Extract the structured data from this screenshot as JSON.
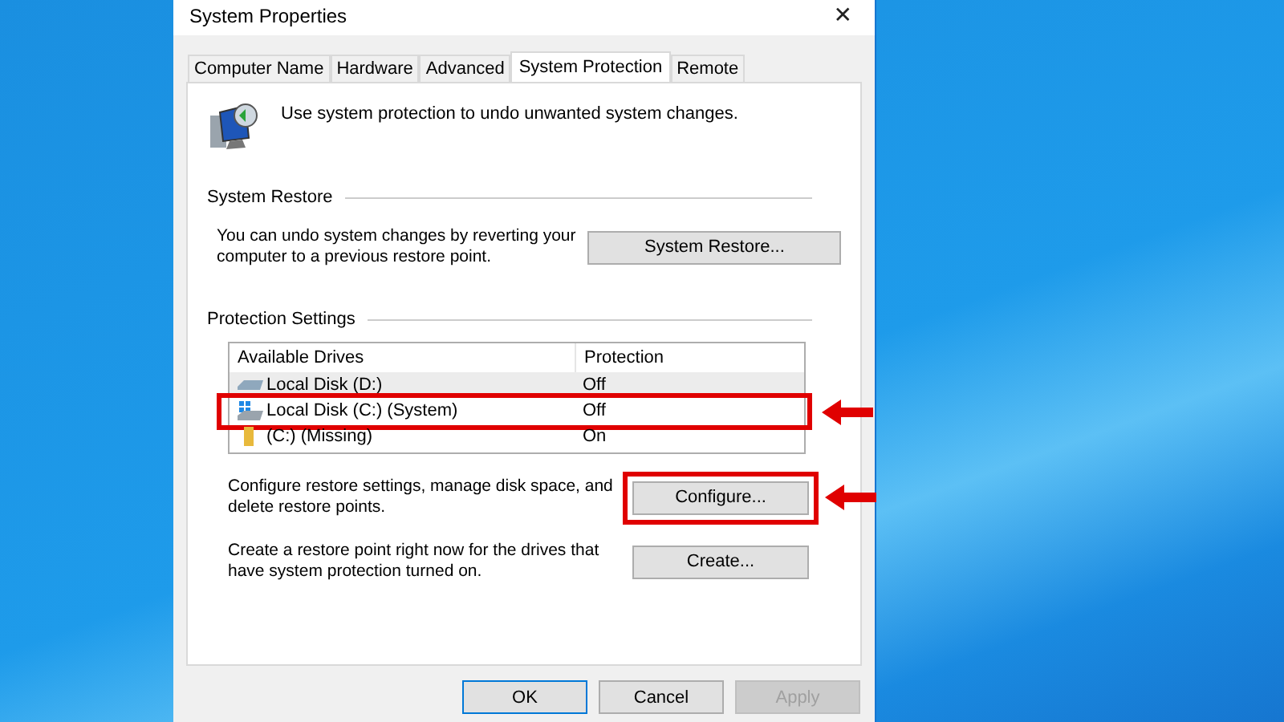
{
  "window": {
    "title": "System Properties",
    "close": "✕"
  },
  "tabs": [
    {
      "label": "Computer Name",
      "selected": false
    },
    {
      "label": "Hardware",
      "selected": false
    },
    {
      "label": "Advanced",
      "selected": false
    },
    {
      "label": "System Protection",
      "selected": true
    },
    {
      "label": "Remote",
      "selected": false
    }
  ],
  "intro": "Use system protection to undo unwanted system changes.",
  "system_restore": {
    "heading": "System Restore",
    "text": "You can undo system changes by reverting your computer to a previous restore point.",
    "button": {
      "label": "System Restore..."
    }
  },
  "protection_settings": {
    "heading": "Protection Settings",
    "columns": [
      "Available Drives",
      "Protection"
    ],
    "drives": [
      {
        "kind": "disk",
        "name": "Local Disk (D:)",
        "protection": "Off",
        "selected": true,
        "highlighted": false
      },
      {
        "kind": "system-disk",
        "name": "Local Disk (C:) (System)",
        "protection": "Off",
        "selected": false,
        "highlighted": true
      },
      {
        "kind": "folder",
        "name": "(C:) (Missing)",
        "protection": "On",
        "selected": false,
        "highlighted": false
      }
    ],
    "actions": [
      {
        "text": "Configure restore settings, manage disk space, and delete restore points.",
        "button": "Configure...",
        "highlighted": true
      },
      {
        "text": "Create a restore point right now for the drives that have system protection turned on.",
        "button": "Create...",
        "highlighted": false
      }
    ]
  },
  "buttons": [
    {
      "label": "OK",
      "kind": "default",
      "disabled": false
    },
    {
      "label": "Cancel",
      "kind": "normal",
      "disabled": false
    },
    {
      "label": "Apply",
      "kind": "normal",
      "disabled": true
    }
  ]
}
